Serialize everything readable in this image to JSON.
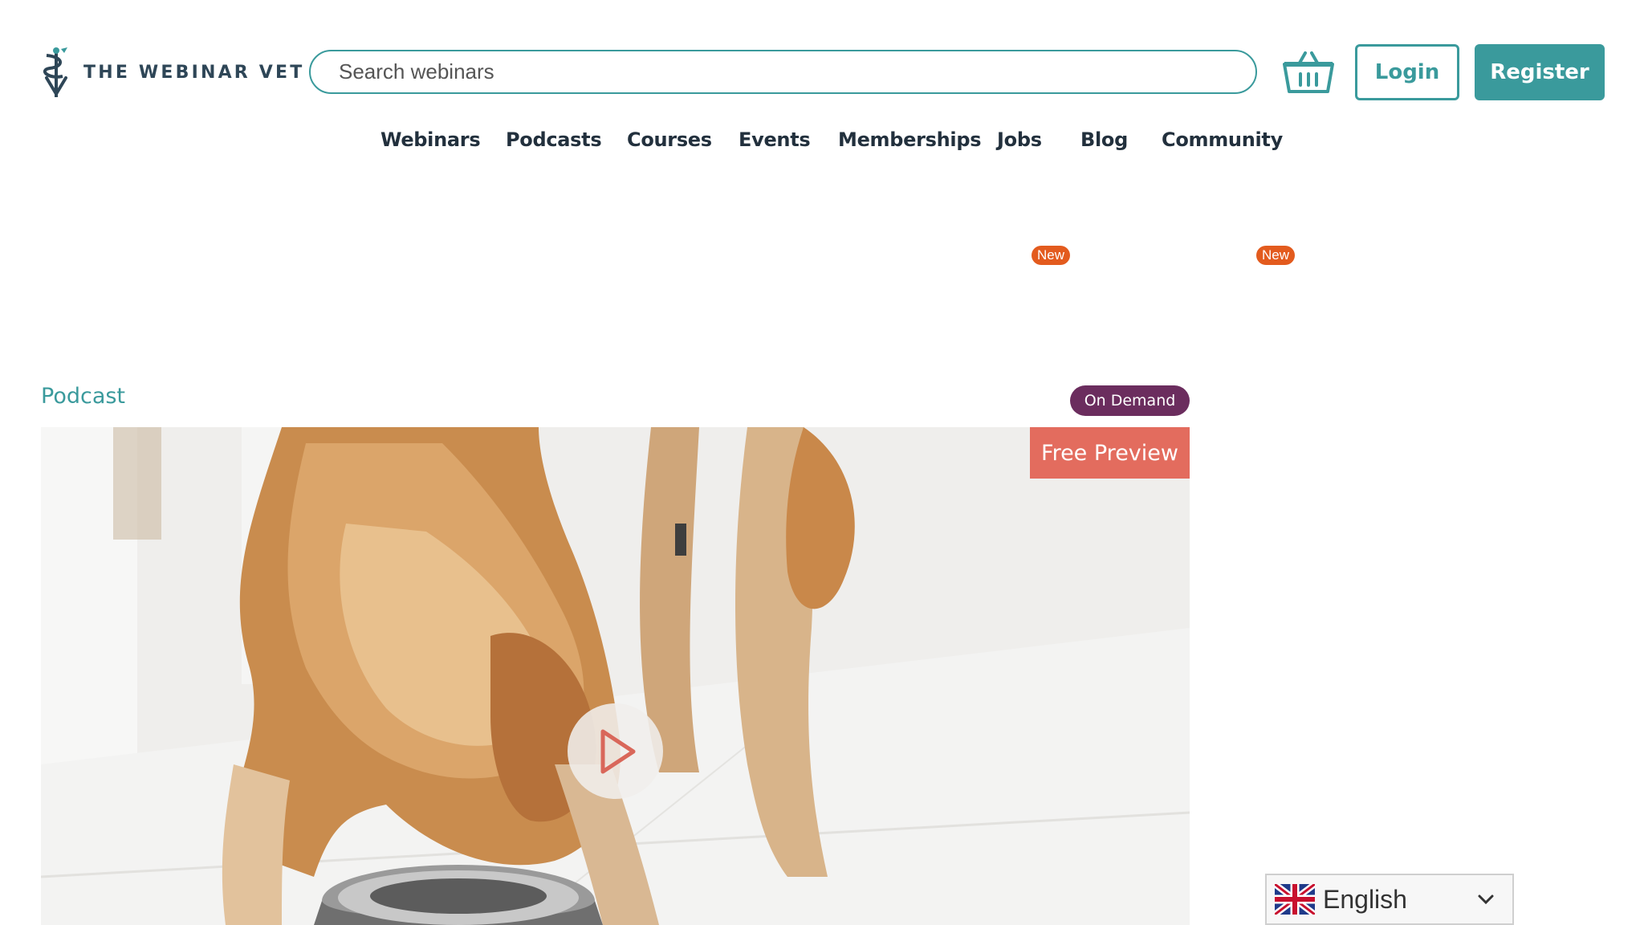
{
  "header": {
    "logo_text": "THE WEBINAR VET",
    "search_placeholder": "Search webinars",
    "login_label": "Login",
    "register_label": "Register"
  },
  "nav": {
    "items": [
      {
        "label": "Webinars"
      },
      {
        "label": "Podcasts"
      },
      {
        "label": "Courses"
      },
      {
        "label": "Events"
      },
      {
        "label": "Memberships"
      },
      {
        "label": "Jobs",
        "badge": "New"
      },
      {
        "label": "Blog"
      },
      {
        "label": "Community",
        "badge": "New"
      }
    ]
  },
  "card": {
    "type_label": "Podcast",
    "status_badge": "On Demand",
    "preview_label": "Free Preview"
  },
  "language": {
    "selected": "English"
  },
  "colors": {
    "accent": "#3a9a9c",
    "badge_new": "#e35b1e",
    "on_demand": "#6b2d5e",
    "free_preview": "#e36c5e"
  }
}
